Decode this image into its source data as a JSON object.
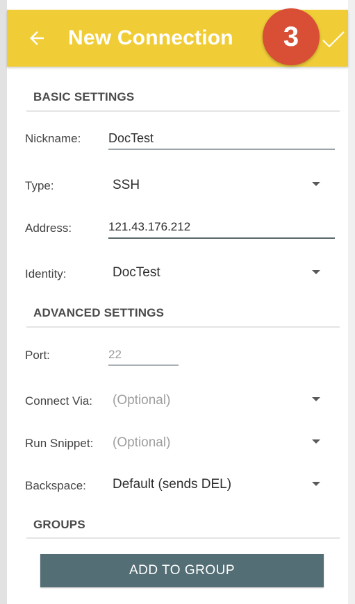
{
  "header": {
    "title": "New Connection",
    "step_number": "3",
    "back_icon": "arrow-left-icon",
    "confirm_icon": "checkmark-icon",
    "bar_color": "#f0cd37",
    "badge_color": "#d84f35"
  },
  "sections": {
    "basic": "BASIC SETTINGS",
    "advanced": "ADVANCED SETTINGS",
    "groups": "GROUPS"
  },
  "fields": {
    "nickname": {
      "label": "Nickname:",
      "value": "DocTest"
    },
    "type": {
      "label": "Type:",
      "value": "SSH"
    },
    "address": {
      "label": "Address:",
      "value": "121.43.176.212"
    },
    "identity": {
      "label": "Identity:",
      "value": "DocTest"
    },
    "port": {
      "label": "Port:",
      "value": "22"
    },
    "connect_via": {
      "label": "Connect Via:",
      "placeholder": "(Optional)"
    },
    "run_snippet": {
      "label": "Run Snippet:",
      "placeholder": "(Optional)"
    },
    "backspace": {
      "label": "Backspace:",
      "value": "Default (sends DEL)"
    }
  },
  "buttons": {
    "add_to_group": "ADD TO GROUP",
    "button_color": "#546e75"
  }
}
